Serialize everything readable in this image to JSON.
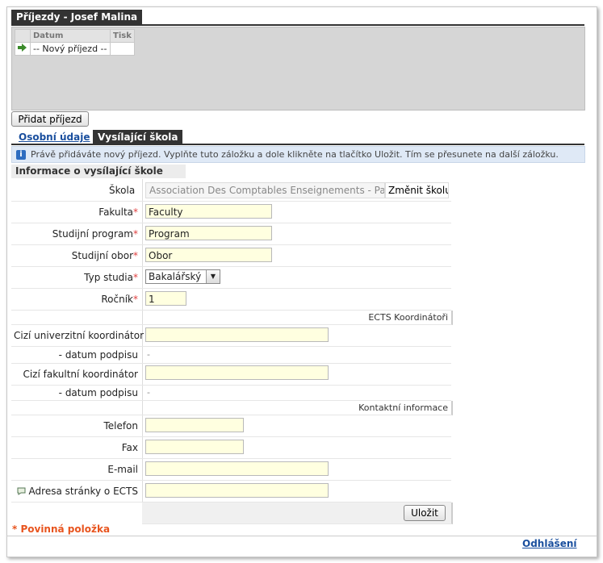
{
  "header": {
    "title": "Příjezdy - Josef Malina"
  },
  "grid": {
    "columns": [
      "Datum",
      "Tisk"
    ],
    "rows": [
      {
        "datum": "-- Nový příjezd --",
        "tisk": ""
      }
    ]
  },
  "toolbar": {
    "add_label": "Přidat příjezd"
  },
  "tabs": [
    {
      "label": "Osobní údaje"
    },
    {
      "label": "Vysílající škola"
    }
  ],
  "info": {
    "text": "Právě přidáváte nový příjezd. Vyplňte tuto záložku a dole klikněte na tlačítko Uložit. Tím se přesunete na další záložku."
  },
  "section": {
    "title": "Informace o vysílající škole"
  },
  "form": {
    "skola": {
      "label": "Škola",
      "value": "Association Des Comptables Enseignements - Par",
      "button": "Změnit školu"
    },
    "fakulta": {
      "label": "Fakulta",
      "req": "*",
      "value": "Faculty"
    },
    "program": {
      "label": "Studijní program",
      "req": "*",
      "value": "Program"
    },
    "obor": {
      "label": "Studijní obor",
      "req": "*",
      "value": "Obor"
    },
    "typ": {
      "label": "Typ studia",
      "req": "*",
      "value": "Bakalářský"
    },
    "rocnik": {
      "label": "Ročník",
      "req": "*",
      "value": "1"
    },
    "ects_header": "ECTS Koordinátoři",
    "cizi_univ": {
      "label": "Cizí univerzitní koordinátor",
      "value": ""
    },
    "datum1": {
      "label": "- datum podpisu",
      "value": "-"
    },
    "cizi_fak": {
      "label": "Cizí fakultní koordinátor",
      "value": ""
    },
    "datum2": {
      "label": "- datum podpisu",
      "value": "-"
    },
    "kontakt_header": "Kontaktní informace",
    "telefon": {
      "label": "Telefon",
      "value": ""
    },
    "fax": {
      "label": "Fax",
      "value": ""
    },
    "email": {
      "label": "E-mail",
      "value": ""
    },
    "ects_url": {
      "label": "Adresa stránky o ECTS",
      "value": ""
    },
    "save_label": "Uložit"
  },
  "footer": {
    "required_note": "* Povinná položka",
    "logout": "Odhlášení"
  }
}
